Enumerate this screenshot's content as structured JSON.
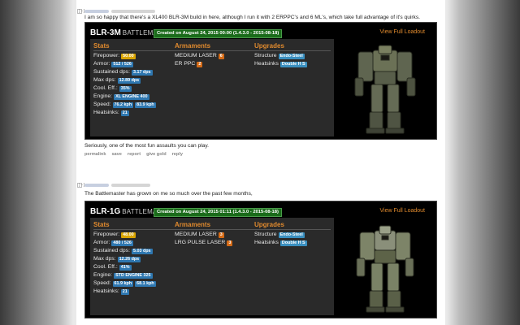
{
  "comments": [
    {
      "toggle": "[–]",
      "text": "I am so happy that there's a XL400 BLR-3M build in here, although I run it with 2 ERPPC's and 6 ML's, which take full advantage of it's quirks.",
      "loadout": {
        "mech_id": "BLR-3M",
        "mech_class": "BATTLEMASTER",
        "created": "Created on August 24, 2015 00:00 (1.4.3.0 - 2015-08-18)",
        "view_full": "View Full Loadout",
        "headers": {
          "stats": "Stats",
          "armaments": "Armaments",
          "upgrades": "Upgrades"
        },
        "stats": [
          {
            "label": "Firepower:",
            "badges": [
              {
                "text": "50.00",
                "color": "yellow"
              }
            ]
          },
          {
            "label": "Armor:",
            "badges": [
              {
                "text": "512 / 526",
                "color": "blue"
              }
            ]
          },
          {
            "label": "Sustained dps:",
            "badges": [
              {
                "text": "3.17 dps",
                "color": "blue"
              }
            ]
          },
          {
            "label": "Max dps:",
            "badges": [
              {
                "text": "12.89 dps",
                "color": "blue"
              }
            ]
          },
          {
            "label": "Cool. Eff.:",
            "badges": [
              {
                "text": "35%",
                "color": "blue"
              }
            ]
          },
          {
            "label": "Engine:",
            "badges": [
              {
                "text": "XL ENGINE 400",
                "color": "blue"
              }
            ]
          },
          {
            "label": "Speed:",
            "badges": [
              {
                "text": "76.2 kph",
                "color": "blue"
              },
              {
                "text": "83.9 kph",
                "color": "blue"
              }
            ]
          },
          {
            "label": "Heatsinks:",
            "badges": [
              {
                "text": "21",
                "color": "blue"
              }
            ]
          }
        ],
        "armaments": [
          {
            "label": "MEDIUM LASER",
            "count": "6"
          },
          {
            "label": "ER PPC",
            "count": "2"
          }
        ],
        "upgrades": [
          {
            "label": "Structure",
            "value": "Endo-Steel"
          },
          {
            "label": "Heatsinks",
            "value": "Double H S"
          }
        ]
      },
      "after_text": "Seriously, one of the most fun assaults you can play.",
      "actions": [
        "permalink",
        "save",
        "report",
        "give gold",
        "reply"
      ]
    },
    {
      "toggle": "[–]",
      "text": "The Battlemaster has grown on me so much over the past few months,",
      "loadout": {
        "mech_id": "BLR-1G",
        "mech_class": "BATTLEMASTER",
        "created": "Created on August 24, 2015 01:11 (1.4.3.0 - 2015-08-18)",
        "view_full": "View Full Loadout",
        "headers": {
          "stats": "Stats",
          "armaments": "Armaments",
          "upgrades": "Upgrades"
        },
        "stats": [
          {
            "label": "Firepower:",
            "badges": [
              {
                "text": "48.00",
                "color": "yellow"
              }
            ]
          },
          {
            "label": "Armor:",
            "badges": [
              {
                "text": "480 / 526",
                "color": "blue"
              }
            ]
          },
          {
            "label": "Sustained dps:",
            "badges": [
              {
                "text": "5.03 dps",
                "color": "blue"
              }
            ]
          },
          {
            "label": "Max dps:",
            "badges": [
              {
                "text": "12.26 dps",
                "color": "blue"
              }
            ]
          },
          {
            "label": "Cool. Eff.:",
            "badges": [
              {
                "text": "41%",
                "color": "blue"
              }
            ]
          },
          {
            "label": "Engine:",
            "badges": [
              {
                "text": "STD ENGINE 325",
                "color": "blue"
              }
            ]
          },
          {
            "label": "Speed:",
            "badges": [
              {
                "text": "61.9 kph",
                "color": "blue"
              },
              {
                "text": "68.1 kph",
                "color": "blue"
              }
            ]
          },
          {
            "label": "Heatsinks:",
            "badges": [
              {
                "text": "21",
                "color": "blue"
              }
            ]
          }
        ],
        "armaments": [
          {
            "label": "MEDIUM LASER",
            "count": "3"
          },
          {
            "label": "LRG PULSE LASER",
            "count": "3"
          }
        ],
        "upgrades": [
          {
            "label": "Structure",
            "value": "Endo-Steel"
          },
          {
            "label": "Heatsinks",
            "value": "Double H S"
          }
        ]
      }
    }
  ],
  "colors": {
    "accent_orange": "#e08a2e",
    "badge_blue": "#2e77b0",
    "badge_yellow": "#d9a400",
    "badge_orange": "#d46a16",
    "created_green": "#1a6b1a"
  }
}
